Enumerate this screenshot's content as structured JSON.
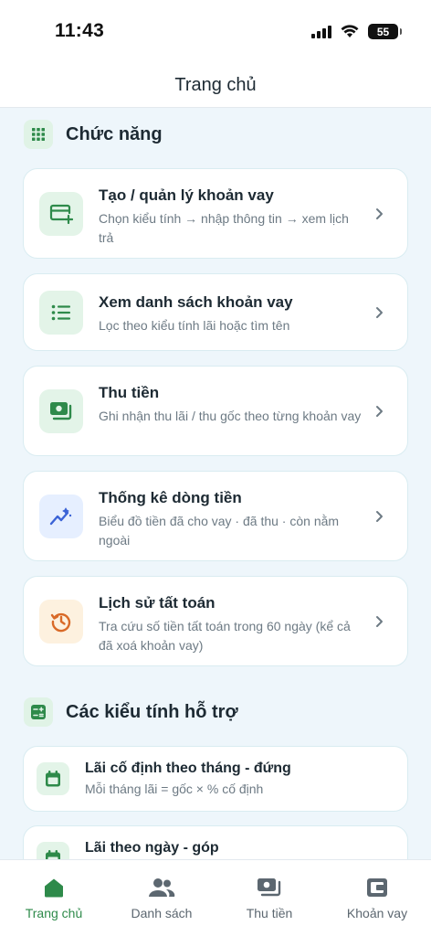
{
  "status_bar": {
    "time": "11:43",
    "battery": "55"
  },
  "header": {
    "title": "Trang chủ"
  },
  "sections": {
    "functions": {
      "title": "Chức năng"
    },
    "types": {
      "title": "Các kiểu tính hỗ trợ"
    }
  },
  "function_cards": [
    {
      "title": "Tạo / quản lý khoản vay",
      "subtitle": "Chọn kiểu tính → nhập thông tin → xem lịch trả",
      "icon": "card-add-icon"
    },
    {
      "title": "Xem danh sách khoản vay",
      "subtitle": "Lọc theo kiểu tính lãi hoặc tìm tên",
      "icon": "list-icon"
    },
    {
      "title": "Thu tiền",
      "subtitle": "Ghi nhận thu lãi / thu gốc theo từng khoản vay",
      "icon": "cash-icon"
    },
    {
      "title": "Thống kê dòng tiền",
      "subtitle": "Biểu đồ tiền đã cho vay · đã thu · còn nằm ngoài",
      "icon": "trend-icon"
    },
    {
      "title": "Lịch sử tất toán",
      "subtitle": "Tra cứu số tiền tất toán trong 60 ngày (kể cả đã xoá khoản vay)",
      "icon": "history-icon"
    }
  ],
  "type_cards": [
    {
      "title": "Lãi cố định theo tháng - đứng",
      "subtitle": "Mỗi tháng lãi = gốc × % cố định",
      "icon": "calendar-icon"
    },
    {
      "title": "Lãi theo ngày - góp",
      "subtitle": "",
      "icon": "calendar-icon"
    }
  ],
  "tabbar": {
    "items": [
      {
        "label": "Trang chủ",
        "icon": "home-icon",
        "active": true
      },
      {
        "label": "Danh sách",
        "icon": "people-icon",
        "active": false
      },
      {
        "label": "Thu tiền",
        "icon": "cash-icon",
        "active": false
      },
      {
        "label": "Khoản vay",
        "icon": "wallet-icon",
        "active": false
      }
    ]
  },
  "colors": {
    "accent": "#2e8a4a",
    "background": "#eef6fb",
    "blue_icon": "#3b63d6",
    "orange_icon": "#d96a28"
  }
}
